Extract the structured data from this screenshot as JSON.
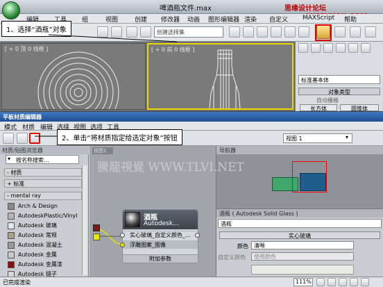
{
  "titlebar": {
    "title": "啤酒瓶文件.max",
    "brand": "思缘设计论坛 www.MISSYUAN.COM"
  },
  "menubar": {
    "items": [
      "编辑",
      "工具",
      "组",
      "视图",
      "创建",
      "修改器",
      "动画",
      "图形编辑器",
      "渲染",
      "自定义",
      "MAXScript",
      "帮助"
    ]
  },
  "toolbar": {
    "selection_set": "创建选择集"
  },
  "viewports": {
    "top_label": "[ + 0 顶 0 线框 ]",
    "front_label": "[ + 0 前 0 线框 ]"
  },
  "command_panel": {
    "category": "标准基本体",
    "section": "对象类型",
    "autogrid": "自动栅格",
    "btn1": "长方体",
    "btn2": "圆锥体"
  },
  "callouts": {
    "step1": "1、选择“酒瓶”对象",
    "step2": "2、单击“将材质指定给选定对象”按钮"
  },
  "slate": {
    "title": "平板材质编辑器",
    "menu": [
      "模式",
      "材质",
      "编辑",
      "选择",
      "视图",
      "选项",
      "工具"
    ],
    "view_dropdown": "视图 1",
    "browser_header": "材质/贴图浏览器",
    "search_placeholder": "按名称搜索...",
    "groups": {
      "materials": "- 材质",
      "standard": "+ 标准",
      "mental_ray": "- mental ray"
    },
    "mr_items": [
      "Arch & Design",
      "AutodeskPlastic/Vinyl",
      "Autodesk 玻璃",
      "Autodesk 常规",
      "Autodesk 混凝土",
      "Autodesk 金属",
      "Autodesk 金属漆",
      "Autodesk 镜子"
    ],
    "view1_tab": "视图1",
    "navigator": "导航器",
    "watermark": "騰龍視覺 WWW.TLVI.NET",
    "node": {
      "name": "酒瓶",
      "type": "Autodesk...",
      "slot1": "实心玻璃_自定义颜色_...",
      "slot2": "浮雕图案_图像",
      "more": "附加参数"
    },
    "params": {
      "header": "酒瓶 ( Autodesk Solid Glass )",
      "name_field": "酒瓶",
      "rollout": "实心玻璃",
      "color_label": "颜色",
      "color_value": "清晰",
      "custom_color_label": "自定义颜色",
      "custom_color_value": "使用颜色"
    },
    "status": "已完成渲染",
    "zoom": "111%"
  },
  "colors": {
    "highlight": "#e00000",
    "nav_box": "#ff0000",
    "node_blue": "#1f5e8c",
    "node_green": "#3fa86a"
  }
}
